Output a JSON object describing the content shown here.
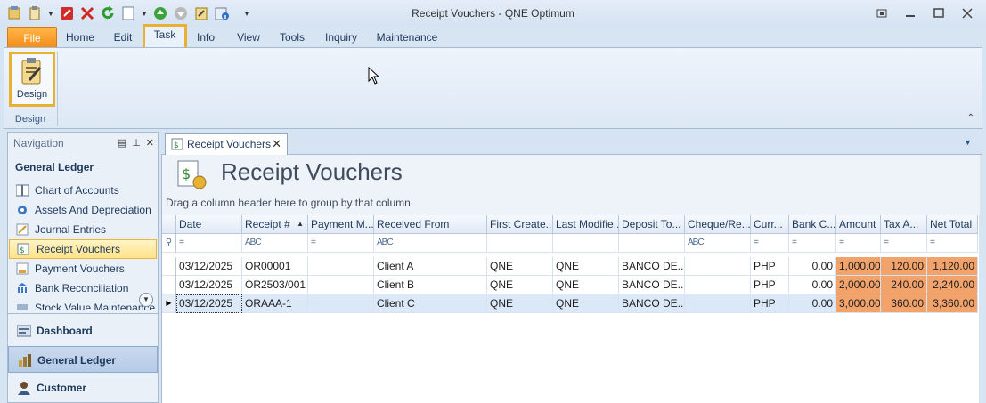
{
  "window": {
    "title": "Receipt Vouchers - QNE Optimum"
  },
  "ribbon": {
    "tabs": [
      {
        "label": "File"
      },
      {
        "label": "Home"
      },
      {
        "label": "Edit"
      },
      {
        "label": "Task"
      },
      {
        "label": "Info"
      },
      {
        "label": "View"
      },
      {
        "label": "Tools"
      },
      {
        "label": "Inquiry"
      },
      {
        "label": "Maintenance"
      }
    ],
    "active_tab": "Task",
    "design_label": "Design",
    "group_label": "Design"
  },
  "navigation": {
    "header": "Navigation",
    "section": "General Ledger",
    "items": [
      {
        "label": "Chart of Accounts",
        "icon": "book-icon"
      },
      {
        "label": "Assets And Depreciation",
        "icon": "gear-icon"
      },
      {
        "label": "Journal Entries",
        "icon": "pencil-icon"
      },
      {
        "label": "Receipt Vouchers",
        "icon": "receipt-icon"
      },
      {
        "label": "Payment Vouchers",
        "icon": "payment-icon"
      },
      {
        "label": "Bank Reconciliation",
        "icon": "bank-icon"
      },
      {
        "label": "Stock Value Maintenance",
        "icon": "stock-icon"
      }
    ],
    "selected_item": "Receipt Vouchers",
    "bottom": [
      {
        "label": "Dashboard",
        "icon": "dashboard-icon"
      },
      {
        "label": "General Ledger",
        "icon": "ledger-icon"
      },
      {
        "label": "Customer",
        "icon": "customer-icon"
      }
    ]
  },
  "document": {
    "tab_label": "Receipt Vouchers",
    "title": "Receipt Vouchers",
    "group_hint": "Drag a column header here to group by that column"
  },
  "grid": {
    "columns": [
      {
        "key": "date",
        "label": "Date"
      },
      {
        "key": "receipt",
        "label": "Receipt #"
      },
      {
        "key": "payment",
        "label": "Payment M..."
      },
      {
        "key": "from",
        "label": "Received From"
      },
      {
        "key": "first",
        "label": "First Create..."
      },
      {
        "key": "last",
        "label": "Last Modifie..."
      },
      {
        "key": "deposit",
        "label": "Deposit To..."
      },
      {
        "key": "cheque",
        "label": "Cheque/Re..."
      },
      {
        "key": "curr",
        "label": "Curr..."
      },
      {
        "key": "bank",
        "label": "Bank C..."
      },
      {
        "key": "amount",
        "label": "Amount"
      },
      {
        "key": "tax",
        "label": "Tax A..."
      },
      {
        "key": "net",
        "label": "Net Total"
      }
    ],
    "filter_symbols": [
      "=",
      "ABC",
      "=",
      "ABC",
      "",
      "",
      "",
      "ABC",
      "=",
      "=",
      "=",
      "=",
      "="
    ],
    "rows": [
      {
        "date": "03/12/2025",
        "receipt": "OR00001",
        "payment": "",
        "from": "Client A",
        "first": "QNE",
        "last": "QNE",
        "deposit": "BANCO DE...",
        "cheque": "",
        "curr": "PHP",
        "bank": "0.00",
        "amount": "1,000.00",
        "tax": "120.00",
        "net": "1,120.00"
      },
      {
        "date": "03/12/2025",
        "receipt": "OR2503/001",
        "payment": "",
        "from": "Client B",
        "first": "QNE",
        "last": "QNE",
        "deposit": "BANCO DE...",
        "cheque": "",
        "curr": "PHP",
        "bank": "0.00",
        "amount": "2,000.00",
        "tax": "240.00",
        "net": "2,240.00"
      },
      {
        "date": "03/12/2025",
        "receipt": "ORAAA-1",
        "payment": "",
        "from": "Client C",
        "first": "QNE",
        "last": "QNE",
        "deposit": "BANCO DE...",
        "cheque": "",
        "curr": "PHP",
        "bank": "0.00",
        "amount": "3,000.00",
        "tax": "360.00",
        "net": "3,360.00"
      }
    ],
    "current_row_index": 2
  },
  "colors": {
    "accent_orange": "#f18f1c",
    "highlight_border": "#e8b134",
    "amount_fill": "#f2a36b"
  }
}
